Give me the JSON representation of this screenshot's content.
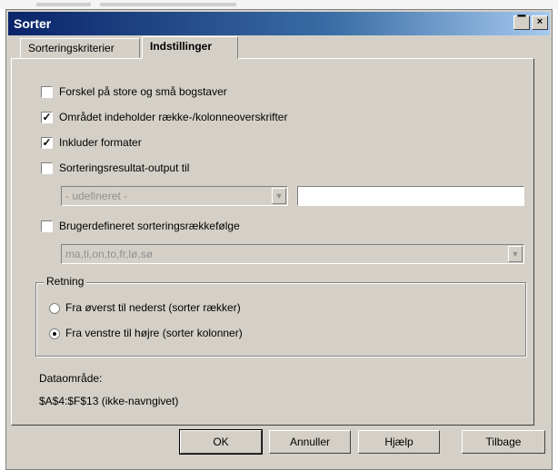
{
  "window": {
    "title": "Sorter",
    "minimize_label": "▔",
    "close_label": "×"
  },
  "tabs": [
    {
      "label": "Sorteringskriterier",
      "active": false
    },
    {
      "label": "Indstillinger",
      "active": true
    }
  ],
  "options": {
    "case_sensitive": {
      "label": "Forskel på store og små bogstaver",
      "checked": false
    },
    "has_headers": {
      "label": "Området indeholder række-/kolonneoverskrifter",
      "checked": true
    },
    "include_formats": {
      "label": "Inkluder formater",
      "checked": true
    },
    "copy_results": {
      "label": "Sorteringsresultat-output til",
      "checked": false
    },
    "output_combo": {
      "value": "- udefineret -"
    },
    "output_field": {
      "value": ""
    },
    "custom_order": {
      "label": "Brugerdefineret sorteringsrækkefølge",
      "checked": false
    },
    "custom_combo": {
      "value": "ma,ti,on,to,fr,lø,sø"
    }
  },
  "direction": {
    "legend": "Retning",
    "top_to_bottom": {
      "label": "Fra øverst til nederst (sorter rækker)",
      "selected": false
    },
    "left_to_right": {
      "label": "Fra venstre til højre (sorter kolonner)",
      "selected": true
    }
  },
  "data_area": {
    "label": "Dataområde:",
    "value": "$A$4:$F$13 (ikke-navngivet)"
  },
  "buttons": {
    "ok": "OK",
    "cancel": "Annuller",
    "help": "Hjælp",
    "reset": "Tilbage"
  },
  "check_mark": "✓",
  "combo_arrow": "▼"
}
